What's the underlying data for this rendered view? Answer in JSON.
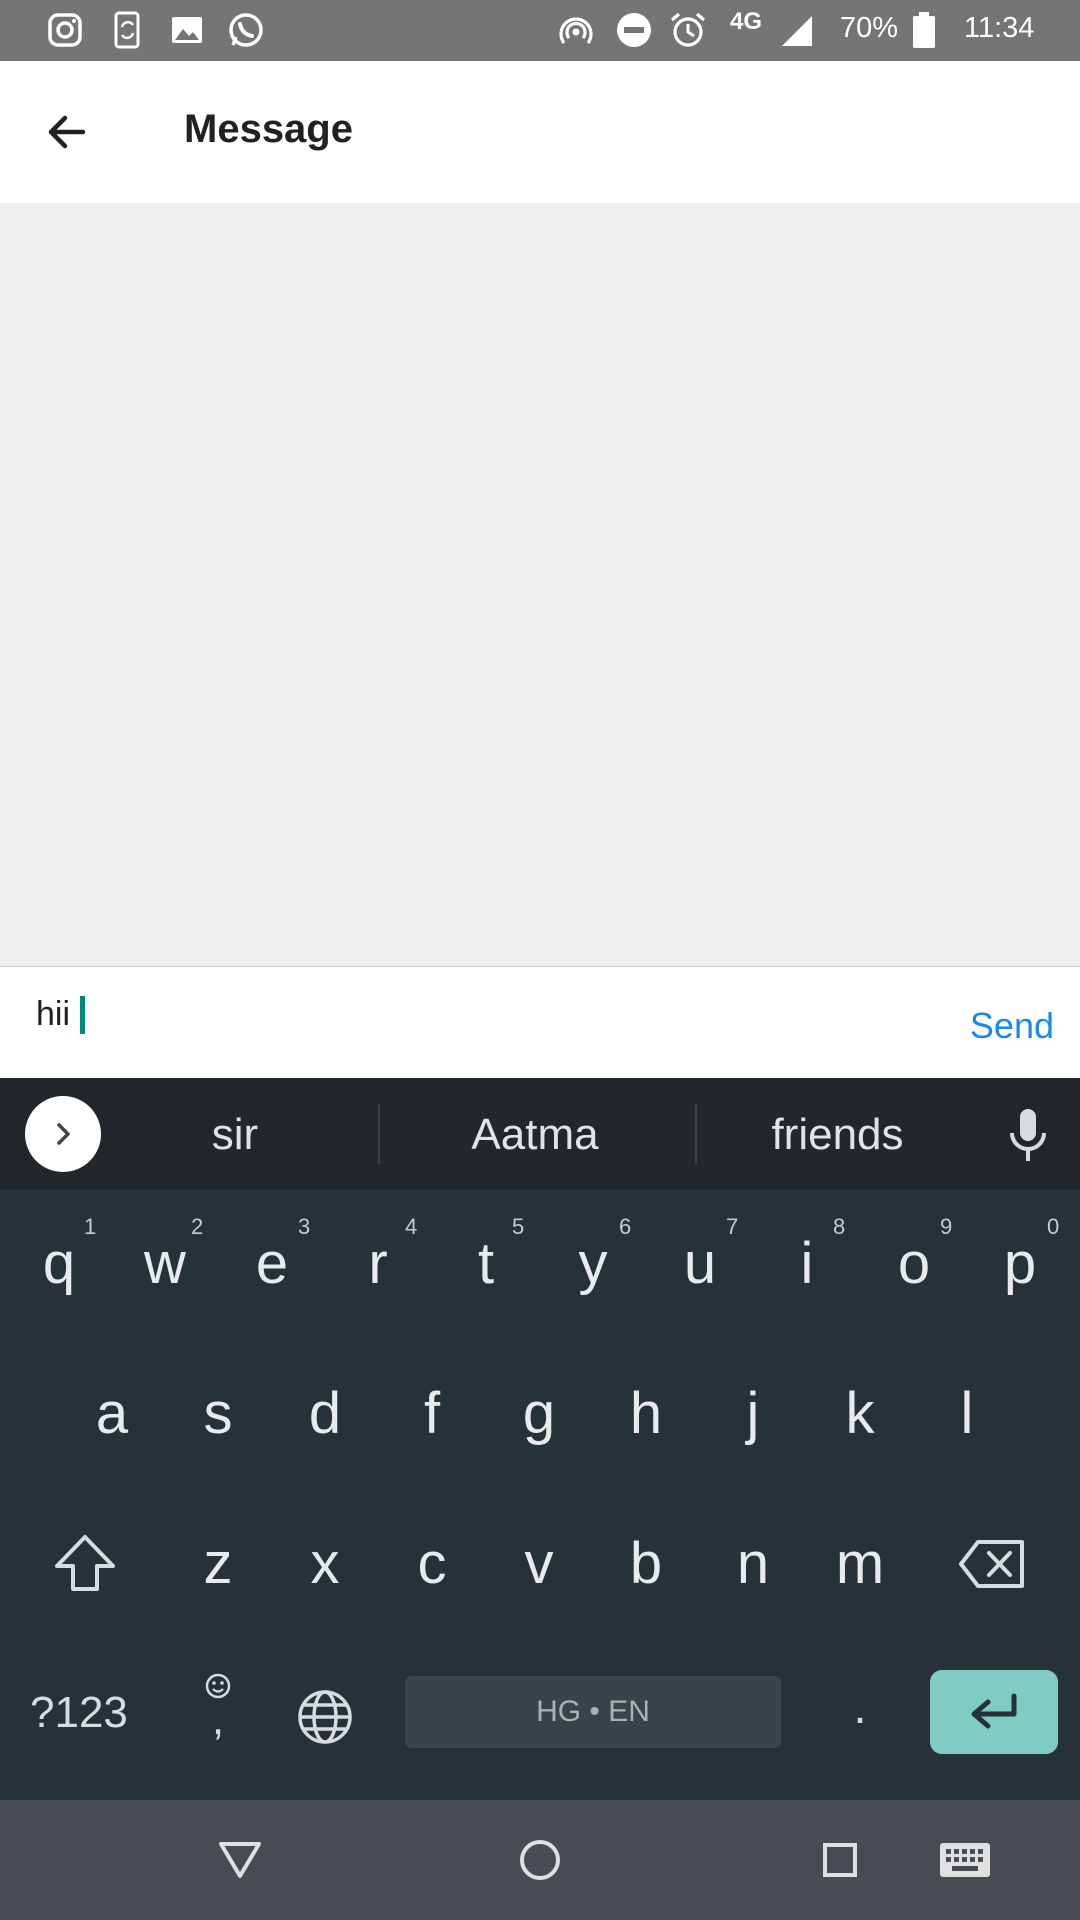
{
  "status_bar": {
    "network": "4G",
    "battery": "70%",
    "time": "11:34",
    "left_icons": [
      "instagram-icon",
      "phone-sync-icon",
      "image-icon",
      "whatsapp-icon"
    ],
    "right_icons": [
      "hotspot-icon",
      "do-not-disturb-icon",
      "alarm-icon",
      "signal-icon",
      "battery-icon"
    ]
  },
  "app_bar": {
    "title": "Message",
    "back_icon": "arrow-back-icon"
  },
  "compose": {
    "value": "hii",
    "send_label": "Send",
    "accent": "#1e88e5",
    "caret_color": "#00897b"
  },
  "keyboard": {
    "suggestions": [
      "sir",
      "Aatma",
      "friends"
    ],
    "row1": [
      {
        "key": "q",
        "hint": "1"
      },
      {
        "key": "w",
        "hint": "2"
      },
      {
        "key": "e",
        "hint": "3"
      },
      {
        "key": "r",
        "hint": "4"
      },
      {
        "key": "t",
        "hint": "5"
      },
      {
        "key": "y",
        "hint": "6"
      },
      {
        "key": "u",
        "hint": "7"
      },
      {
        "key": "i",
        "hint": "8"
      },
      {
        "key": "o",
        "hint": "9"
      },
      {
        "key": "p",
        "hint": "0"
      }
    ],
    "row2": [
      "a",
      "s",
      "d",
      "f",
      "g",
      "h",
      "j",
      "k",
      "l"
    ],
    "row3": [
      "z",
      "x",
      "c",
      "v",
      "b",
      "n",
      "m"
    ],
    "symbols_label": "?123",
    "comma_label": ",",
    "space_label": "HG • EN",
    "period_label": ".",
    "enter_color": "#80cbc4"
  },
  "nav_bar": {
    "icons": [
      "back-triangle-icon",
      "home-circle-icon",
      "recents-square-icon",
      "keyboard-icon"
    ]
  }
}
